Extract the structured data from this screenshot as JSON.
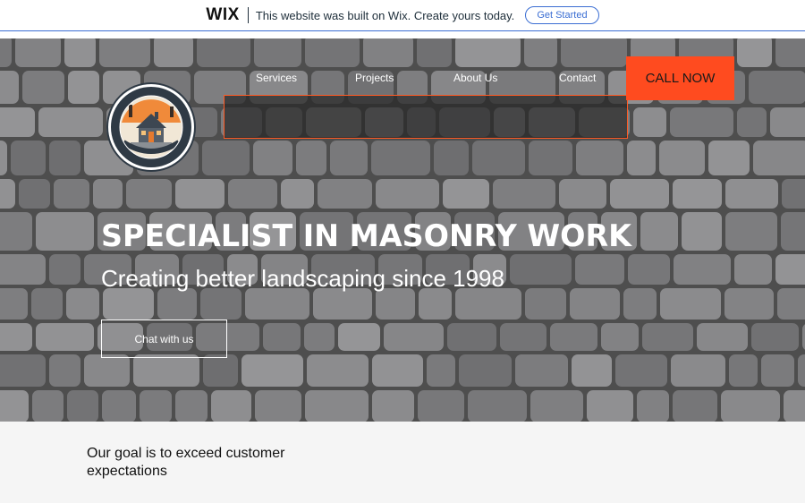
{
  "wix_banner": {
    "logo": "WIX",
    "message": "This website was built on Wix. Create yours today.",
    "button": "Get Started"
  },
  "nav": {
    "items": [
      "Services",
      "Projects",
      "About Us",
      "Contact"
    ],
    "call_button": "CALL NOW"
  },
  "hero": {
    "title": "SPECIALIST IN MASONRY WORK",
    "subtitle": "Creating better landscaping since 1998",
    "chat_button": "Chat with us"
  },
  "section": {
    "goal_text": "Our goal is to exceed customer expectations"
  },
  "colors": {
    "accent": "#ff4b1f",
    "wix_blue": "#3b6ed3"
  },
  "icons": {
    "logo": "house-badge-logo"
  }
}
